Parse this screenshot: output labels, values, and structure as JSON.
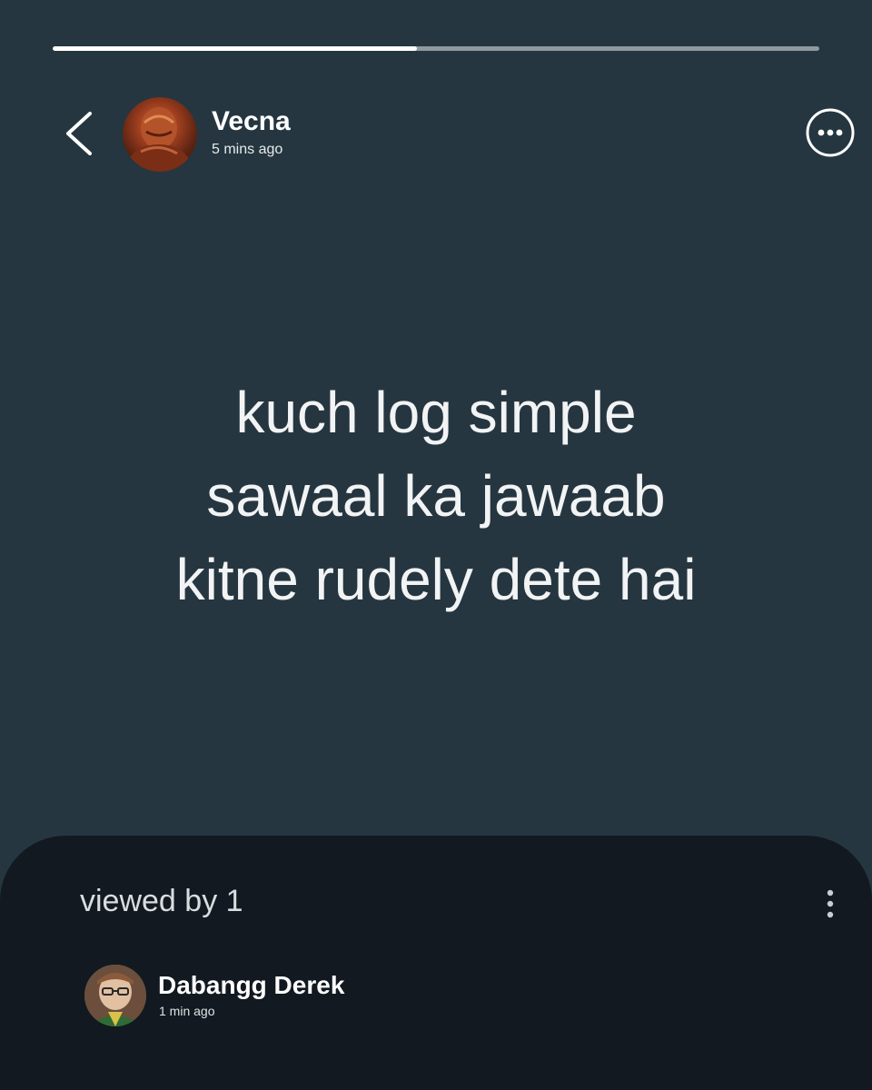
{
  "status_progress": {
    "fraction": 0.475
  },
  "header": {
    "author_name": "Vecna",
    "posted_time": "5 mins ago"
  },
  "status": {
    "lines": [
      "kuch log simple",
      "sawaal ka jawaab",
      "kitne rudely dete hai"
    ]
  },
  "viewers_panel": {
    "title": "viewed by 1",
    "viewers": [
      {
        "name": "Dabangg Derek",
        "time": "1 min ago"
      }
    ]
  },
  "icons": {
    "back": "back-chevron-icon",
    "more": "more-options-icon",
    "panel_menu": "vertical-dots-icon"
  },
  "colors": {
    "background": "#253640",
    "panel": "#121920",
    "progress_track": "#8f999f",
    "progress_fill": "#ffffff"
  }
}
